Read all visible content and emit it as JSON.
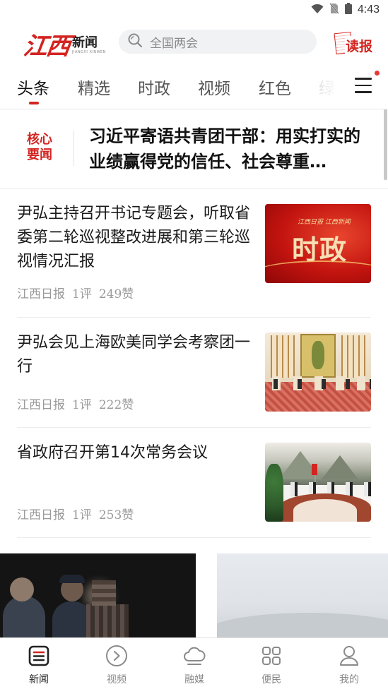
{
  "status_bar": {
    "time": "4:43",
    "icons": [
      "wifi-icon",
      "no-sim-icon",
      "battery-icon"
    ]
  },
  "header": {
    "logo_main": "江西",
    "logo_sub": "新闻",
    "logo_sub_en": "JIANGXI XINWEN",
    "search_placeholder": "全国两会",
    "dubao_label": "读报"
  },
  "tabs": [
    {
      "label": "头条",
      "active": true
    },
    {
      "label": "精选",
      "active": false
    },
    {
      "label": "时政",
      "active": false
    },
    {
      "label": "视频",
      "active": false
    },
    {
      "label": "红色",
      "active": false
    },
    {
      "label": "绿",
      "active": false
    }
  ],
  "headline": {
    "badge_line1": "核心",
    "badge_line2": "要闻",
    "text": "习近平寄语共青团干部：用实打实的业绩赢得党的信任、社会尊重…"
  },
  "news": [
    {
      "title": "尹弘主持召开书记专题会，听取省委第二轮巡视整改进展和第三轮巡视情况汇报",
      "source": "江西日报",
      "comments": "1评",
      "likes": "249赞",
      "thumb_text_small": "江西日报 江西新闻",
      "thumb_text_big": "时政"
    },
    {
      "title": "尹弘会见上海欧美同学会考察团一行",
      "source": "江西日报",
      "comments": "1评",
      "likes": "222赞"
    },
    {
      "title": "省政府召开第14次常务会议",
      "source": "江西日报",
      "comments": "1评",
      "likes": "253赞"
    }
  ],
  "bottom_nav": [
    {
      "label": "新闻",
      "icon": "news-icon",
      "active": true
    },
    {
      "label": "视频",
      "icon": "play-circle-icon",
      "active": false
    },
    {
      "label": "融媒",
      "icon": "cloud-icon",
      "active": false
    },
    {
      "label": "便民",
      "icon": "grid-icon",
      "active": false
    },
    {
      "label": "我的",
      "icon": "user-icon",
      "active": false
    }
  ],
  "colors": {
    "accent": "#d32420",
    "text_primary": "#1a1a1a",
    "text_meta": "#9a9a9a"
  }
}
